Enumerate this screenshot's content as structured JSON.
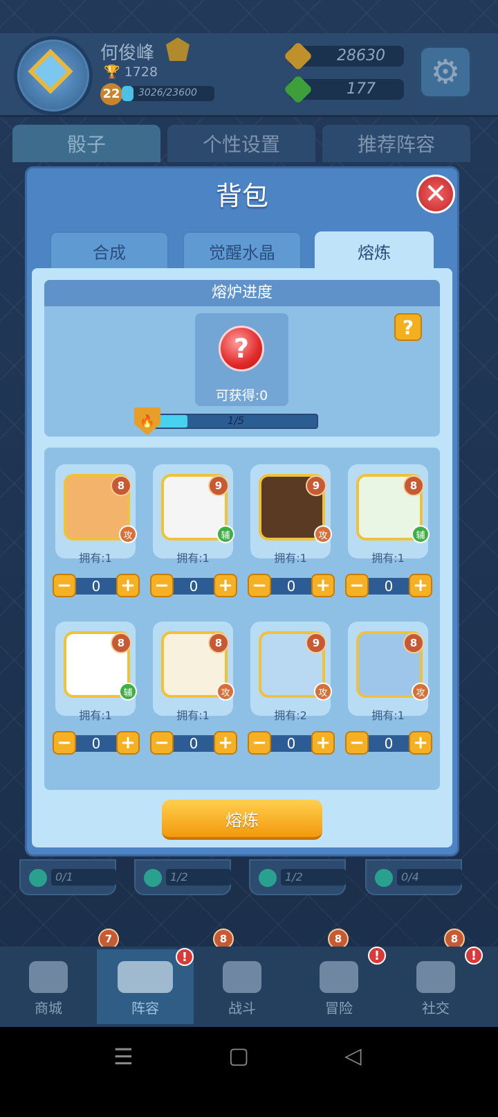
{
  "player": {
    "name": "何俊峰",
    "trophies": "1728",
    "level": "22",
    "xp": "3026/23600",
    "xp_progress": 0.128
  },
  "currency": {
    "coins": "28630",
    "gems": "177"
  },
  "top_tabs": [
    {
      "label": "骰子",
      "active": true
    },
    {
      "label": "个性设置",
      "active": false
    },
    {
      "label": "推荐阵容",
      "active": false
    }
  ],
  "modal": {
    "title": "背包",
    "close_icon": "close-icon",
    "tabs": [
      {
        "label": "合成",
        "active": false
      },
      {
        "label": "觉醒水晶",
        "active": false
      },
      {
        "label": "熔炼",
        "active": true
      }
    ],
    "furnace": {
      "header": "熔炉进度",
      "obtainable": "可获得:0",
      "progress_text": "1/5",
      "progress": 0.2,
      "help_label": "?",
      "reward_icon": "question-icon"
    },
    "items": [
      {
        "level": "8",
        "type": "攻",
        "owned": "拥有:1",
        "count": "0",
        "icon": "grenade-icon"
      },
      {
        "level": "9",
        "type": "辅",
        "owned": "拥有:1",
        "count": "0",
        "icon": "skull-icon"
      },
      {
        "level": "9",
        "type": "攻",
        "owned": "拥有:1",
        "count": "0",
        "icon": "beast-icon"
      },
      {
        "level": "8",
        "type": "辅",
        "owned": "拥有:1",
        "count": "0",
        "icon": "heal-cross-icon"
      },
      {
        "level": "8",
        "type": "辅",
        "owned": "拥有:1",
        "count": "0",
        "icon": "web-icon"
      },
      {
        "level": "8",
        "type": "攻",
        "owned": "拥有:1",
        "count": "0",
        "icon": "star-burst-icon"
      },
      {
        "level": "9",
        "type": "攻",
        "owned": "拥有:2",
        "count": "0",
        "icon": "blue-star-icon"
      },
      {
        "level": "8",
        "type": "攻",
        "owned": "拥有:1",
        "count": "0",
        "icon": "fairy-icon"
      }
    ],
    "stepper": {
      "minus": "−",
      "plus": "+"
    },
    "smelt_button": "熔炼"
  },
  "background_rows": [
    "0/1",
    "1/2",
    "1/2",
    "0/4"
  ],
  "background_levels": [
    "7",
    "8",
    "8",
    "8"
  ],
  "bottom_nav": [
    {
      "label": "商城",
      "badge": "",
      "active": false
    },
    {
      "label": "阵容",
      "badge": "!",
      "active": true
    },
    {
      "label": "战斗",
      "badge": "",
      "active": false
    },
    {
      "label": "冒险",
      "badge": "!",
      "active": false
    },
    {
      "label": "社交",
      "badge": "!",
      "active": false
    }
  ],
  "system_nav": {
    "menu": "☰",
    "home": "▢",
    "back": "◁"
  },
  "colors": {
    "accent_orange": "#f5b123",
    "modal_blue": "#4d84c4",
    "panel_light": "#bfe3f8",
    "attack_badge": "#d6703a",
    "support_badge": "#3eae45"
  }
}
